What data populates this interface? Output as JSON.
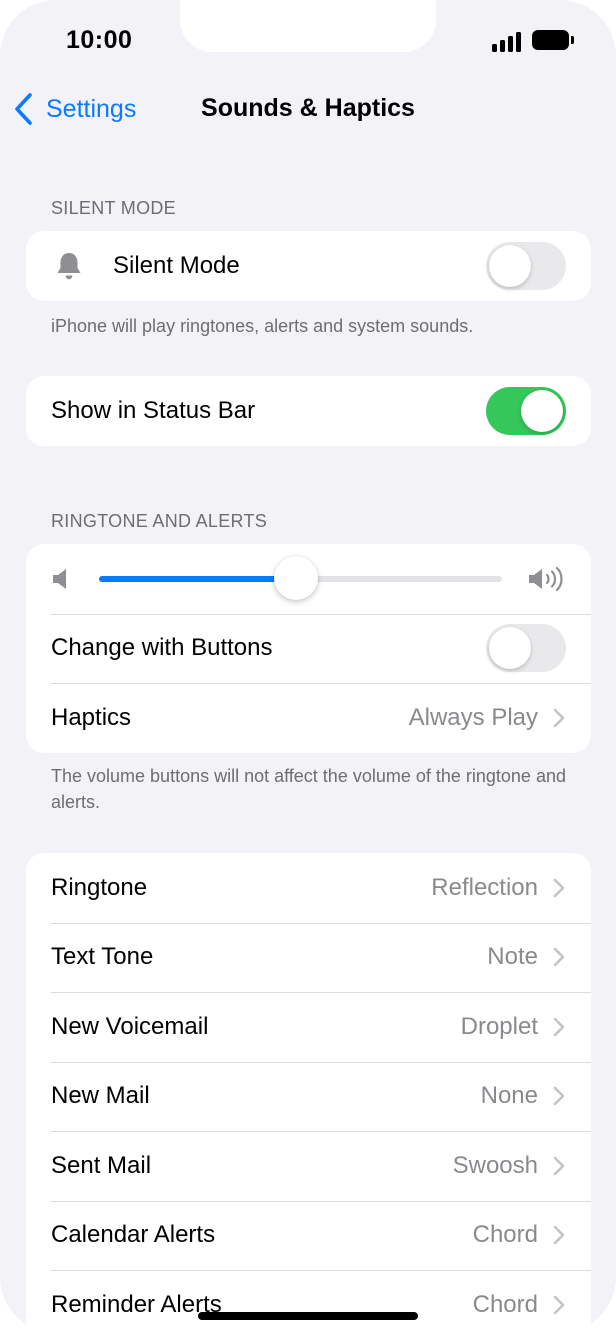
{
  "status_bar": {
    "time": "10:00"
  },
  "nav": {
    "back_label": "Settings",
    "title": "Sounds & Haptics"
  },
  "silent_section": {
    "header": "SILENT MODE",
    "silent_mode_label": "Silent Mode",
    "silent_mode_on": false,
    "footer": "iPhone will play ringtones, alerts and system sounds."
  },
  "status_bar_section": {
    "show_in_status_bar_label": "Show in Status Bar",
    "show_in_status_bar_on": true
  },
  "ringtone_section": {
    "header": "RINGTONE AND ALERTS",
    "volume_level": 0.49,
    "change_with_buttons_label": "Change with Buttons",
    "change_with_buttons_on": false,
    "haptics_label": "Haptics",
    "haptics_value": "Always Play",
    "footer": "The volume buttons will not affect the volume of the ringtone and alerts."
  },
  "sounds_section": {
    "rows": [
      {
        "label": "Ringtone",
        "value": "Reflection"
      },
      {
        "label": "Text Tone",
        "value": "Note"
      },
      {
        "label": "New Voicemail",
        "value": "Droplet"
      },
      {
        "label": "New Mail",
        "value": "None"
      },
      {
        "label": "Sent Mail",
        "value": "Swoosh"
      },
      {
        "label": "Calendar Alerts",
        "value": "Chord"
      },
      {
        "label": "Reminder Alerts",
        "value": "Chord"
      }
    ]
  },
  "colors": {
    "accent": "#0a7aff",
    "toggle_on": "#34c759",
    "background": "#f2f2f7",
    "secondary_text": "#8a8a8e"
  }
}
